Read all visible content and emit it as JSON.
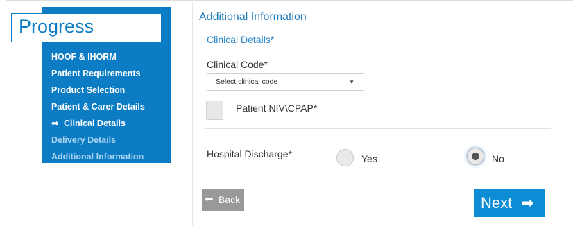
{
  "progress": {
    "title": "Progress",
    "steps": [
      {
        "label": "HOOF & IHORM",
        "state": "done"
      },
      {
        "label": "Patient Requirements",
        "state": "done"
      },
      {
        "label": "Product Selection",
        "state": "done"
      },
      {
        "label": "Patient & Carer Details",
        "state": "done"
      },
      {
        "label": "Clinical Details",
        "state": "current"
      },
      {
        "label": "Delivery Details",
        "state": "pending"
      },
      {
        "label": "Additional Information",
        "state": "pending"
      }
    ],
    "current_marker_icon": "arrow-right-icon"
  },
  "form": {
    "section_title": "Additional Information",
    "subsection_title": "Clinical Details*",
    "clinical_code_label": "Clinical Code*",
    "clinical_code_value": "Select clinical code",
    "niv_label": "Patient NIV\\CPAP*",
    "niv_checked": false,
    "discharge_label": "Hospital Discharge*",
    "discharge_options": [
      {
        "label": "Yes",
        "selected": false
      },
      {
        "label": "No",
        "selected": true
      }
    ]
  },
  "actions": {
    "back_label": "Back",
    "next_label": "Next"
  },
  "colors": {
    "brand_blue": "#0c7cc4",
    "next_button": "#0c8cd4",
    "back_button": "#999999"
  }
}
